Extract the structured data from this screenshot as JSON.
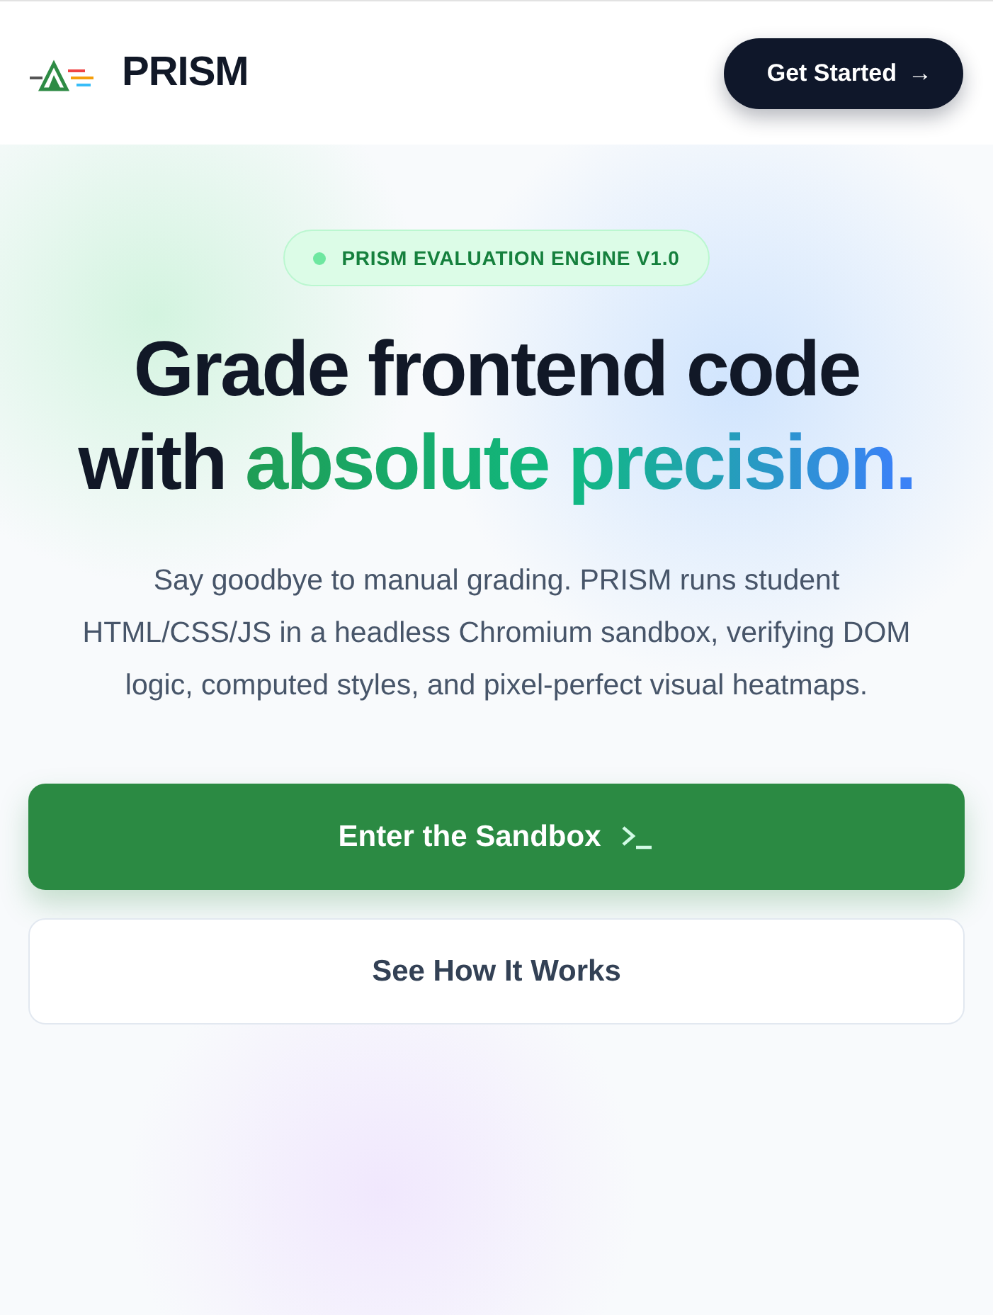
{
  "header": {
    "brand": "PRISM",
    "cta": "Get Started",
    "cta_arrow": "→"
  },
  "badge": {
    "label": "PRISM EVALUATION ENGINE V1.0"
  },
  "headline": {
    "lead": "Grade frontend code with ",
    "accent": "absolute precision",
    "end": "."
  },
  "description": "Say goodbye to manual grading. PRISM runs student HTML/CSS/JS in a headless Chromium sandbox, verifying DOM logic, computed styles, and pixel-perfect visual heatmaps.",
  "buttons": [
    {
      "label": "Enter the Sandbox",
      "kind": "primary"
    },
    {
      "label": "See How It Works",
      "kind": "secondary"
    }
  ]
}
